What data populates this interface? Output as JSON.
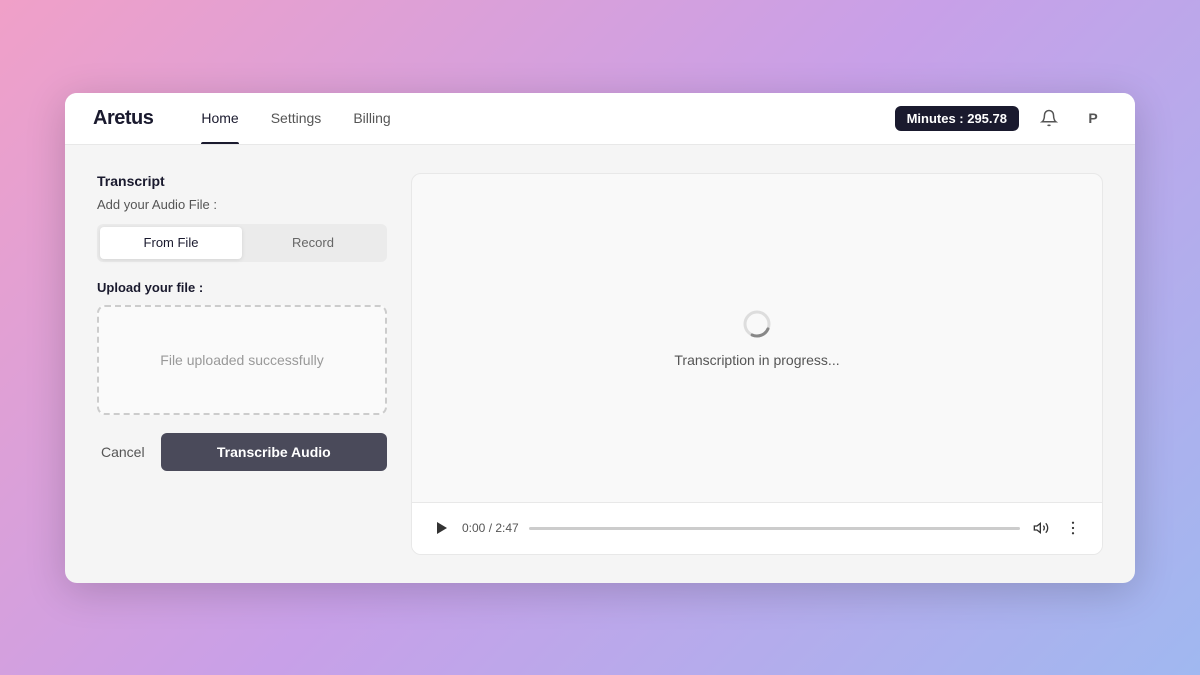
{
  "app": {
    "logo": "Aretus",
    "nav": {
      "links": [
        {
          "label": "Home",
          "active": true
        },
        {
          "label": "Settings",
          "active": false
        },
        {
          "label": "Billing",
          "active": false
        }
      ],
      "minutes_label": "Minutes : 295.78",
      "notification_icon": "🔔",
      "avatar_label": "P"
    }
  },
  "left_panel": {
    "section_title": "Transcript",
    "add_audio_label": "Add your Audio File :",
    "tabs": [
      {
        "label": "From File",
        "active": true
      },
      {
        "label": "Record",
        "active": false
      }
    ],
    "upload_label": "Upload your file :",
    "upload_success_text": "File uploaded successfully",
    "cancel_button": "Cancel",
    "transcribe_button": "Transcribe Audio"
  },
  "right_panel": {
    "transcription_status": "Transcription in progress...",
    "audio_player": {
      "time_current": "0:00",
      "time_total": "2:47",
      "time_display": "0:00 / 2:47"
    }
  }
}
